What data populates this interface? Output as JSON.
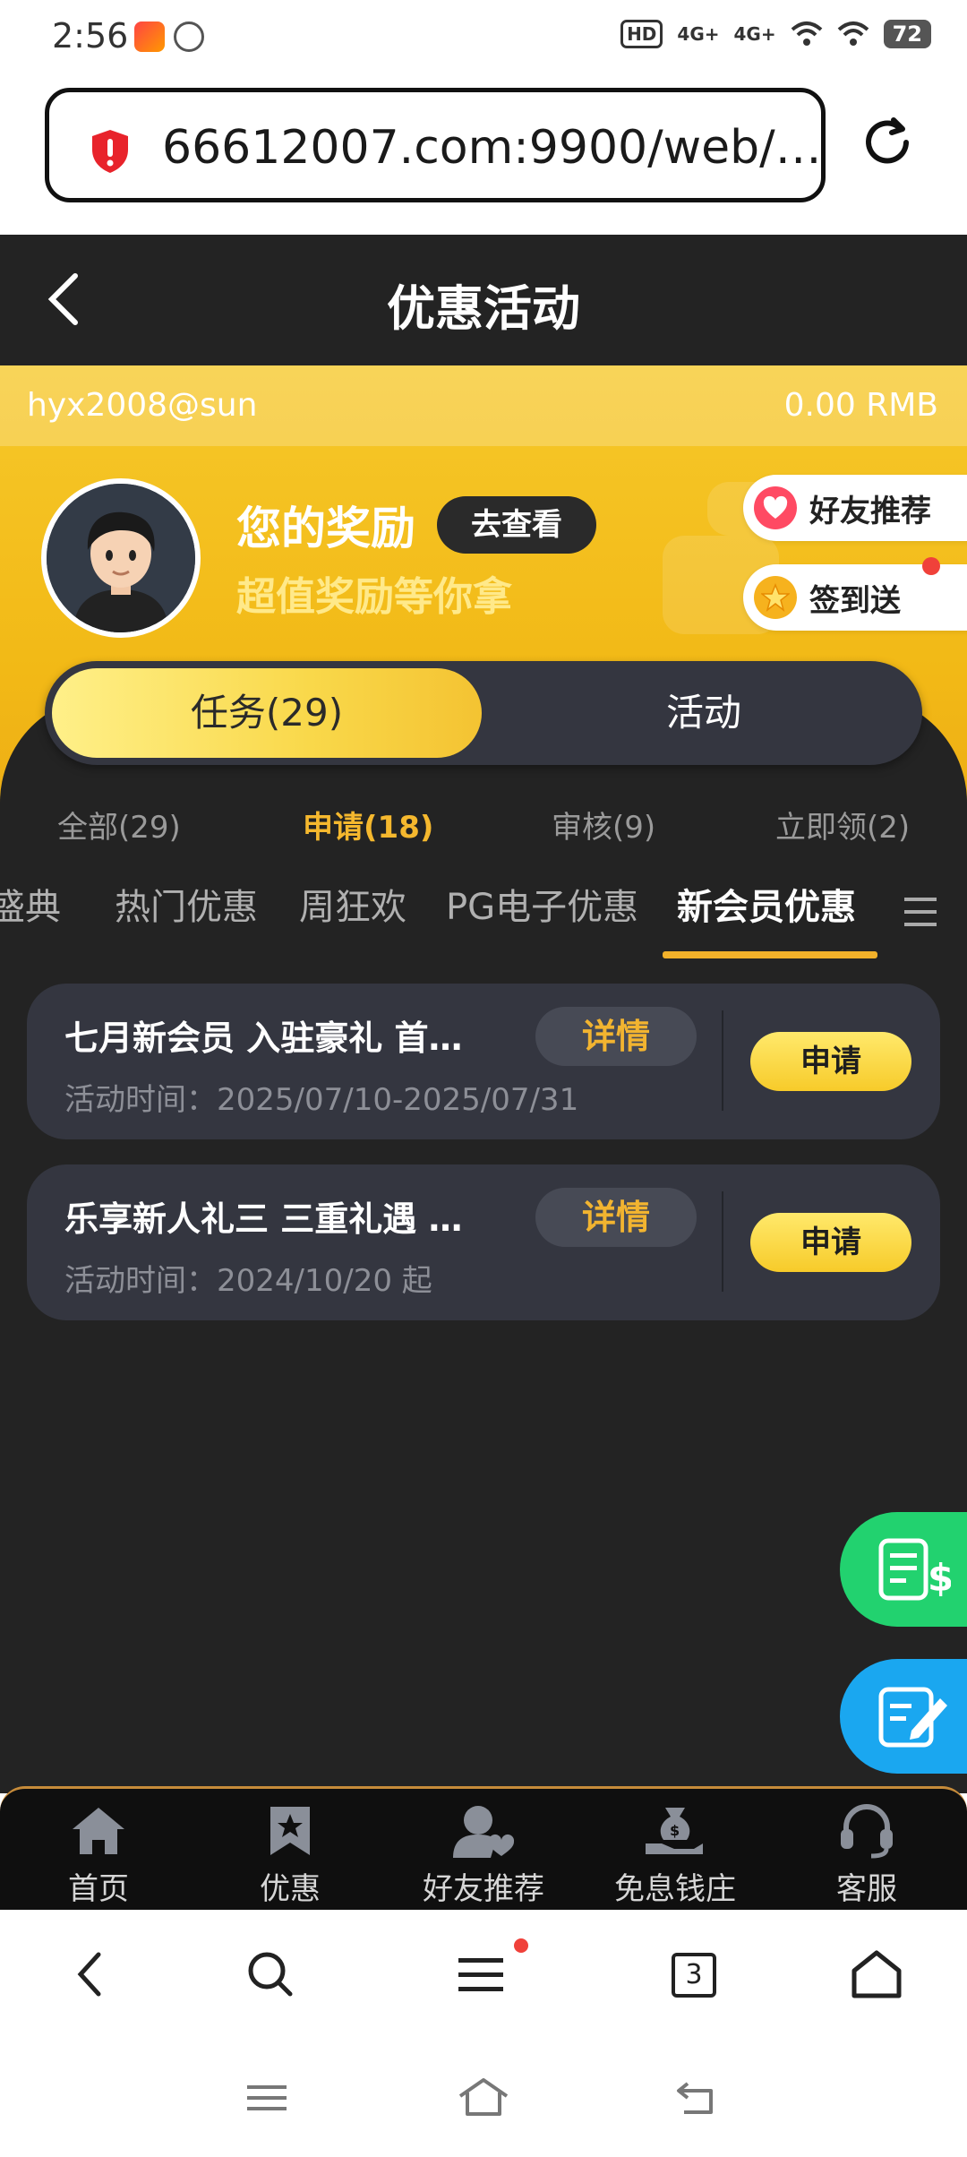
{
  "status_bar": {
    "time": "2:56",
    "hd": "HD",
    "net1": "4G+",
    "net2": "4G+",
    "battery": "72"
  },
  "browser": {
    "url": "66612007.com:9900/web/…",
    "tab_count": "3"
  },
  "header": {
    "title": "优惠活动"
  },
  "banner": {
    "username": "hyx2008@sun",
    "balance": "0.00 RMB",
    "reward_title": "您的奖励",
    "view_button": "去查看",
    "reward_subtitle": "超值奖励等你拿",
    "pills": [
      {
        "label": "好友推荐",
        "icon": "heart-icon"
      },
      {
        "label": "签到送",
        "icon": "star-icon"
      }
    ]
  },
  "segments": {
    "tasks": "任务(29)",
    "activities": "活动"
  },
  "filters": [
    {
      "label": "全部(29)"
    },
    {
      "label": "申请(18)"
    },
    {
      "label": "审核(9)"
    },
    {
      "label": "立即领(2)"
    }
  ],
  "categories": [
    {
      "label": "盛典"
    },
    {
      "label": "热门优惠"
    },
    {
      "label": "周狂欢"
    },
    {
      "label": "PG电子优惠"
    },
    {
      "label": "新会员优惠"
    }
  ],
  "promotions": [
    {
      "title": "七月新会员 入驻豪礼 首…",
      "time": "活动时间：2025/07/10-2025/07/31",
      "detail": "详情",
      "apply": "申请"
    },
    {
      "title": "乐享新人礼三 三重礼遇 …",
      "time": "活动时间：2024/10/20 起",
      "detail": "详情",
      "apply": "申请"
    }
  ],
  "bottom_nav": [
    {
      "label": "首页",
      "icon": "home-icon"
    },
    {
      "label": "优惠",
      "icon": "bookmark-star-icon"
    },
    {
      "label": "好友推荐",
      "icon": "user-heart-icon"
    },
    {
      "label": "免息钱庄",
      "icon": "money-bag-hand-icon"
    },
    {
      "label": "客服",
      "icon": "headset-icon"
    }
  ],
  "colors": {
    "accent": "#f2b12a",
    "banner": "#f2b916",
    "dark": "#232323",
    "card": "#343640"
  }
}
